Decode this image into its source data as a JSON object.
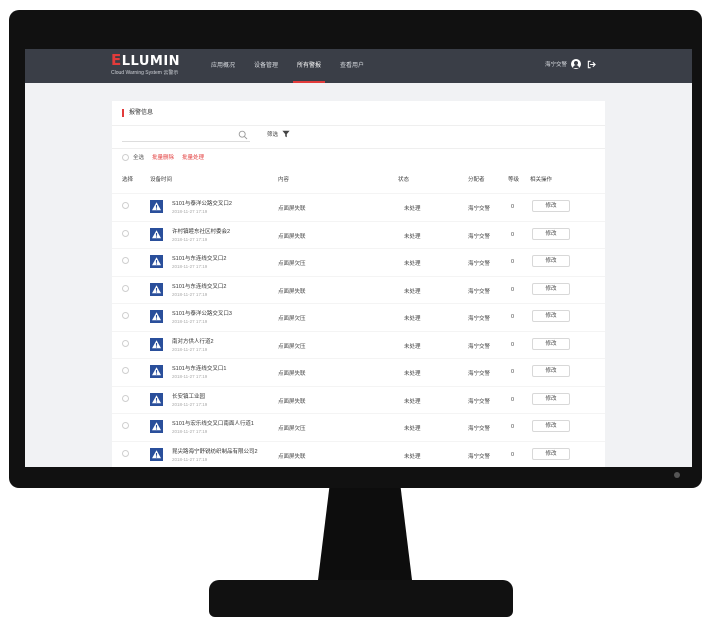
{
  "app": {
    "logo_text": "LLUMIN",
    "logo_letter": "E",
    "logo_subtitle": "Cloud Warning System 云警示"
  },
  "nav": {
    "items": [
      "应用概况",
      "设备管理",
      "所有警报",
      "查看用户"
    ],
    "active_index": 2
  },
  "user": {
    "name": "海宁交警"
  },
  "page": {
    "title": "报警信息",
    "filter_label": "筛选",
    "select_all": "全选",
    "batch_delete": "批量删除",
    "batch_process": "批量处理"
  },
  "table": {
    "headers": [
      "选择",
      "设备时间",
      "内容",
      "状态",
      "分配者",
      "等级",
      "相关操作"
    ],
    "edit_label": "修改",
    "rows": [
      {
        "device": "S101与泰洋公路交叉口2",
        "time": "2018-11-27 17:19",
        "content": "点面屏失联",
        "status": "未处理",
        "assignee": "海宁交警",
        "level": "0"
      },
      {
        "device": "许村镇睦东社区村委会2",
        "time": "2018-11-27 17:19",
        "content": "点面屏失联",
        "status": "未处理",
        "assignee": "海宁交警",
        "level": "0"
      },
      {
        "device": "S101与东连线交叉口2",
        "time": "2018-11-27 17:19",
        "content": "点面屏欠压",
        "status": "未处理",
        "assignee": "海宁交警",
        "level": "0"
      },
      {
        "device": "S101与东连线交叉口2",
        "time": "2018-11-27 17:19",
        "content": "点面屏失联",
        "status": "未处理",
        "assignee": "海宁交警",
        "level": "0"
      },
      {
        "device": "S101与泰洋公路交叉口3",
        "time": "2018-11-27 17:19",
        "content": "点面屏欠压",
        "status": "未处理",
        "assignee": "海宁交警",
        "level": "0"
      },
      {
        "device": "南对方供人行道2",
        "time": "2018-11-27 17:19",
        "content": "点面屏欠压",
        "status": "未处理",
        "assignee": "海宁交警",
        "level": "0"
      },
      {
        "device": "S101与东连线交叉口1",
        "time": "2018-11-27 17:19",
        "content": "点面屏失联",
        "status": "未处理",
        "assignee": "海宁交警",
        "level": "0"
      },
      {
        "device": "长安镇工业园",
        "time": "2018-11-27 17:19",
        "content": "点面屏失联",
        "status": "未处理",
        "assignee": "海宁交警",
        "level": "0"
      },
      {
        "device": "S101与宏乐线交叉口南面人行道1",
        "time": "2018-11-27 17:19",
        "content": "点面屏欠压",
        "status": "未处理",
        "assignee": "海宁交警",
        "level": "0"
      },
      {
        "device": "昆尖路海宁舒锐纺织制品有限公司2",
        "time": "2018-11-27 17:19",
        "content": "点面屏失联",
        "status": "未处理",
        "assignee": "海宁交警",
        "level": "0"
      }
    ]
  },
  "colors": {
    "accent": "#e23b3b",
    "navbar": "#3a3e47",
    "warn_icon": "#2a4f9b"
  }
}
